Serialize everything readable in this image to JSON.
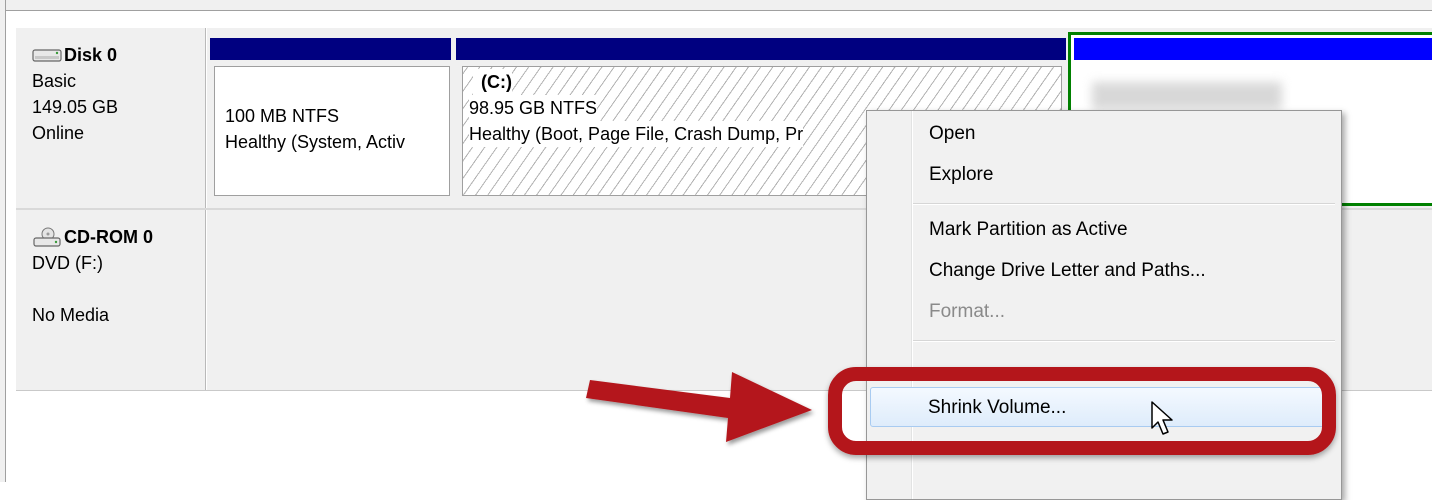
{
  "disks": [
    {
      "name": "Disk 0",
      "type": "Basic",
      "size": "149.05 GB",
      "status": "Online",
      "icon": "hard-disk-icon"
    },
    {
      "name": "CD-ROM 0",
      "type": "DVD (F:)",
      "status": "No Media",
      "icon": "cd-rom-icon"
    }
  ],
  "partitions": [
    {
      "label": "",
      "size_fs": "100 MB NTFS",
      "health": "Healthy (System, Activ"
    },
    {
      "label": "(C:)",
      "size_fs": "98.95 GB NTFS",
      "health": "Healthy (Boot, Page File, Crash Dump, Pr"
    }
  ],
  "context_menu": {
    "items": [
      {
        "label": "Open",
        "enabled": true
      },
      {
        "label": "Explore",
        "enabled": true
      },
      {
        "label": "Mark Partition as Active",
        "enabled": true
      },
      {
        "label": "Change Drive Letter and Paths...",
        "enabled": true
      },
      {
        "label": "Format...",
        "enabled": false
      },
      {
        "label": "Shrink Volume...",
        "enabled": true,
        "highlighted": true
      }
    ]
  },
  "colors": {
    "partition_header": "#000080",
    "selected_partition_header": "#0000ff",
    "selected_border": "#008000",
    "annotation_red": "#b4161b"
  }
}
